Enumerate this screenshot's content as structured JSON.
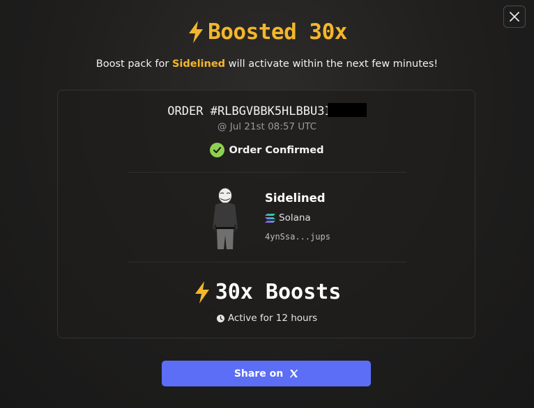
{
  "header": {
    "title": "Boosted 30x",
    "close_icon": "close-icon"
  },
  "subtitle": {
    "prefix": "Boost pack for ",
    "token": "Sidelined",
    "suffix": " will activate within the next few minutes!"
  },
  "order": {
    "number": "ORDER #RLBGVBBK5HLBBU3I",
    "time": "@ Jul 21st 08:57 UTC",
    "status": "Order Confirmed"
  },
  "token": {
    "name": "Sidelined",
    "chain": "Solana",
    "address": "4ynSsa...jups"
  },
  "boost": {
    "label": "30x Boosts",
    "duration": "Active for 12 hours"
  },
  "share": {
    "label": "Share on"
  },
  "colors": {
    "accent": "#f4b72b",
    "success": "#8fd14f",
    "button": "#5b6ef5"
  }
}
